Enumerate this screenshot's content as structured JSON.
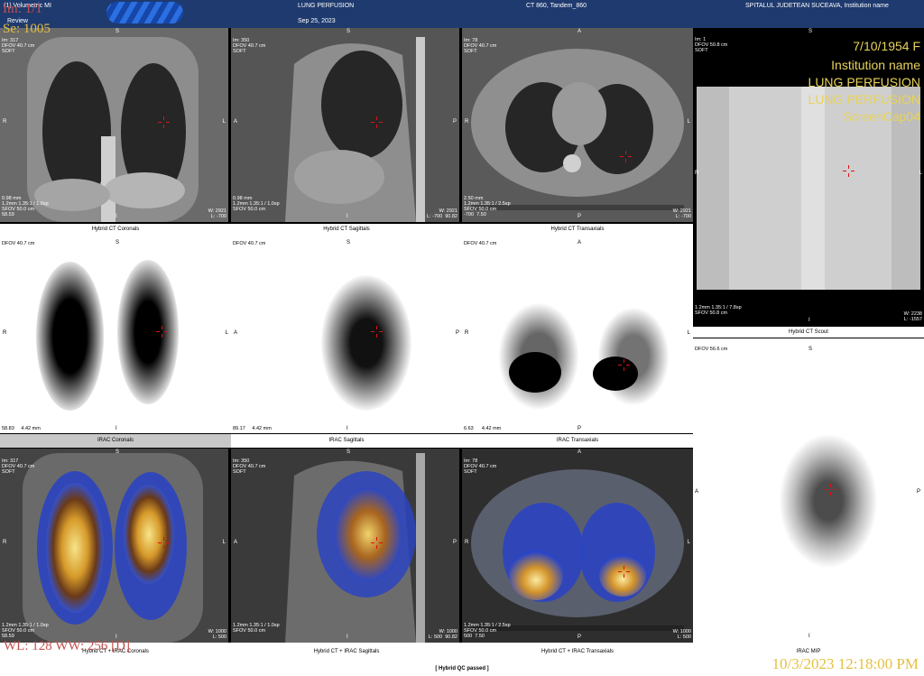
{
  "header": {
    "app_title": "(1) Volumetric MI",
    "review_label": "Review",
    "study": "LUNG PERFUSION",
    "date": "Sep 25, 2023",
    "scanner": "CT 860, Tandem_860",
    "institution": "SPITALUL JUDETEAN SUCEAVA, Institution name"
  },
  "overlay_labels": {
    "image": "Im: 1/1",
    "series": "Se: 1005",
    "window": "WL: 128 WW: 256 [D]",
    "capture_time": "10/3/2023 12:18:00 PM"
  },
  "scout_info": {
    "dob": "7/10/1954 F",
    "institution": "Institution name",
    "study1": "LUNG PERFUSION",
    "study2": "LUNG PERFUSION",
    "capture": "ScreenCap04",
    "tl": "Im: 1\nDFOV 50.8 cm\nSOFT",
    "bl": "1.2mm 1.35:1 / 7.8sp\nSFOV 50.8 cm",
    "br": "W: 2238\nL: -1557",
    "caption": "Hybrid CT Scout",
    "ori_top": "S",
    "ori_left": "R",
    "ori_right": "L",
    "ori_bottom": "I"
  },
  "ct_row": [
    {
      "tl": "Im: 317\nDFOV 40.7 cm\nSOFT",
      "bl": "0.98 mm\n1.2mm 1.35:1 / 1.0sp\nSFOV 50.0 cm\n58.59",
      "br": "W: 2921\nL: -700",
      "caption": "Hybrid CT Coronals",
      "top": "S",
      "left": "R",
      "right": "L",
      "bottom": "I"
    },
    {
      "tl": "Im: 350\nDFOV 40.7 cm\nSOFT",
      "bl": "0.98 mm\n1.2mm 1.35:1 / 1.0sp\nSFOV 50.0 cm",
      "br": "W: 2921\nL: -700  90.82",
      "caption": "Hybrid CT Sagittals",
      "top": "S",
      "left": "A",
      "right": "P",
      "bottom": "I"
    },
    {
      "tl": "Im: 78\nDFOV 40.7 cm\nSOFT",
      "bl": "2.50 mm\n1.2mm 1.35:1 / 2.5sp\nSFOV 50.0 cm\n-700  7.50",
      "br": "W: 2921\nL: -700",
      "caption": "Hybrid CT Transaxials",
      "top": "A",
      "left": "R",
      "right": "L",
      "bottom": "P"
    }
  ],
  "nm_row": [
    {
      "tl": "DFOV 40.7 cm",
      "bl": "58.83     4.42 mm",
      "caption": "IRAC Coronals",
      "top": "S",
      "left": "R",
      "right": "L",
      "bottom": "I"
    },
    {
      "tl": "DFOV 40.7 cm",
      "bl": "89.17     4.42 mm",
      "caption": "IRAC Sagittals",
      "top": "S",
      "left": "A",
      "right": "P",
      "bottom": "I"
    },
    {
      "tl": "DFOV 40.7 cm",
      "bl": "6.63      4.42 mm",
      "caption": "IRAC Transaxials",
      "top": "A",
      "left": "R",
      "right": "L",
      "bottom": "P"
    }
  ],
  "fusion_row": [
    {
      "tl": "Im: 317\nDFOV 40.7 cm\nSOFT",
      "bl": "1.2mm 1.35:1 / 1.0sp\nSFOV 50.0 cm\n58.59",
      "br": "W: 1000\nL: 500",
      "caption": "Hybrid CT + IRAC Coronals",
      "top": "S",
      "left": "R",
      "right": "L",
      "bottom": "I"
    },
    {
      "tl": "Im: 350\nDFOV 40.7 cm\nSOFT",
      "bl": "1.2mm 1.35:1 / 1.0sp\nSFOV 50.0 cm",
      "br": "W: 1000\nL: 500  90.82",
      "caption": "Hybrid CT + IRAC Sagittals",
      "top": "S",
      "left": "A",
      "right": "P",
      "bottom": "I"
    },
    {
      "tl": "Im: 78\nDFOV 40.7 cm\nSOFT",
      "bl": "1.2mm 1.35:1 / 2.5sp\nSFOV 50.0 cm\n500  7.50",
      "br": "W: 1000\nL: 500",
      "caption": "Hybrid CT + IRAC Transaxials",
      "top": "A",
      "left": "R",
      "right": "L",
      "bottom": "P"
    }
  ],
  "mip": {
    "tl": "DFOV 56.6 cm",
    "caption": "IRAC MIP",
    "top": "S",
    "left": "A",
    "right": "P",
    "bottom": "I"
  },
  "status": "[ Hybrid QC passed ]"
}
